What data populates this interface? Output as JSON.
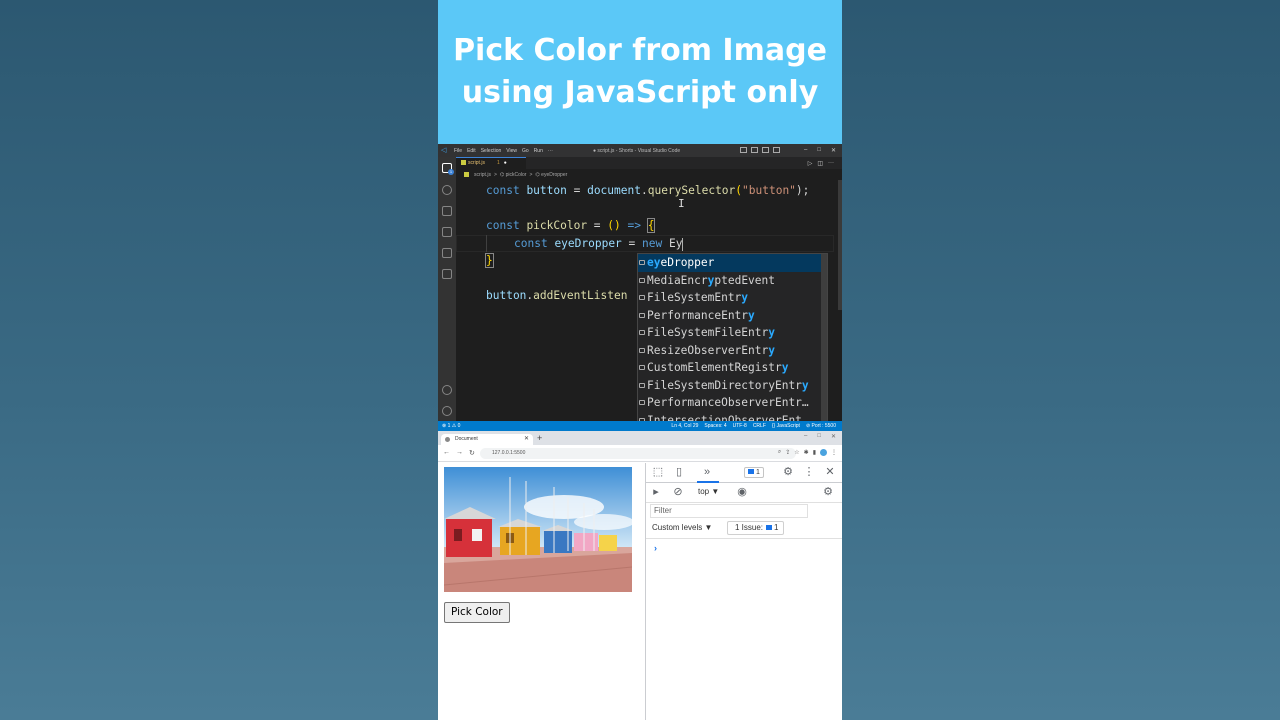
{
  "banner": {
    "title": "Pick Color from Image using JavaScript only"
  },
  "vscode": {
    "menu": [
      "File",
      "Edit",
      "Selection",
      "View",
      "Go",
      "Run",
      "···"
    ],
    "window_title": "● script.js - Shorts - Visual Studio Code",
    "tab": {
      "label": "script.js",
      "problems": "1"
    },
    "breadcrumb": [
      "script.js",
      ">",
      "⌬ pickColor",
      ">",
      "⌬ eyeDropper"
    ],
    "code": {
      "l1": {
        "kw": "const",
        "var": "button",
        "eq": " = ",
        "obj": "document",
        "dot": ".",
        "fn": "querySelector",
        "p1": "(",
        "str": "\"button\"",
        "p2": ");"
      },
      "l3": {
        "kw": "const",
        "fn": "pickColor",
        "eq": " = ",
        "paren": "()",
        "arrow": " => ",
        "brace": "{"
      },
      "l4": {
        "kw": "const",
        "var": "eyeDropper",
        "eq": " = ",
        "new": "new",
        "typed": "Ey"
      },
      "l5": {
        "brace": "}"
      },
      "l7": {
        "var": "button",
        "dot": ".",
        "fn": "addEventListen"
      }
    },
    "suggestions": [
      {
        "pre": "",
        "hl": "ey",
        "post": "eDropper"
      },
      {
        "pre": "MediaEncr",
        "hl": "y",
        "post": "ptedEvent"
      },
      {
        "pre": "FileSystemEntr",
        "hl": "y",
        "post": ""
      },
      {
        "pre": "PerformanceEntr",
        "hl": "y",
        "post": ""
      },
      {
        "pre": "FileSystemFileEntr",
        "hl": "y",
        "post": ""
      },
      {
        "pre": "ResizeObserverEntr",
        "hl": "y",
        "post": ""
      },
      {
        "pre": "CustomElementRegistr",
        "hl": "y",
        "post": ""
      },
      {
        "pre": "FileSystemDirectoryEntr",
        "hl": "y",
        "post": ""
      },
      {
        "pre": "PerformanceObserverEntr",
        "hl": "",
        "post": "…"
      },
      {
        "pre": "IntersectionObserverEnt",
        "hl": "",
        "post": ""
      }
    ],
    "status": {
      "left": "⊗ 1 ⚠ 0",
      "right": [
        "Ln 4, Col 29",
        "Spaces: 4",
        "UTF-8",
        "CRLF",
        "{} JavaScript",
        "⊘ Port : 5500"
      ]
    }
  },
  "browser": {
    "tab_title": "Document",
    "url": "127.0.0.1:5500",
    "button_label": "Pick Color",
    "devtools": {
      "issues_count": "1",
      "context": "top ▼",
      "filter_placeholder": "Filter",
      "levels": "Custom levels ▼",
      "issues_label": "1 Issue:",
      "issues_num": "1",
      "prompt": "›"
    }
  },
  "colors": {
    "banner": "#5bc8f7",
    "editor_bg": "#1e1e1e",
    "statusbar": "#007acc",
    "suggest_selected": "#04395e",
    "match_highlight": "#2aaaff"
  }
}
